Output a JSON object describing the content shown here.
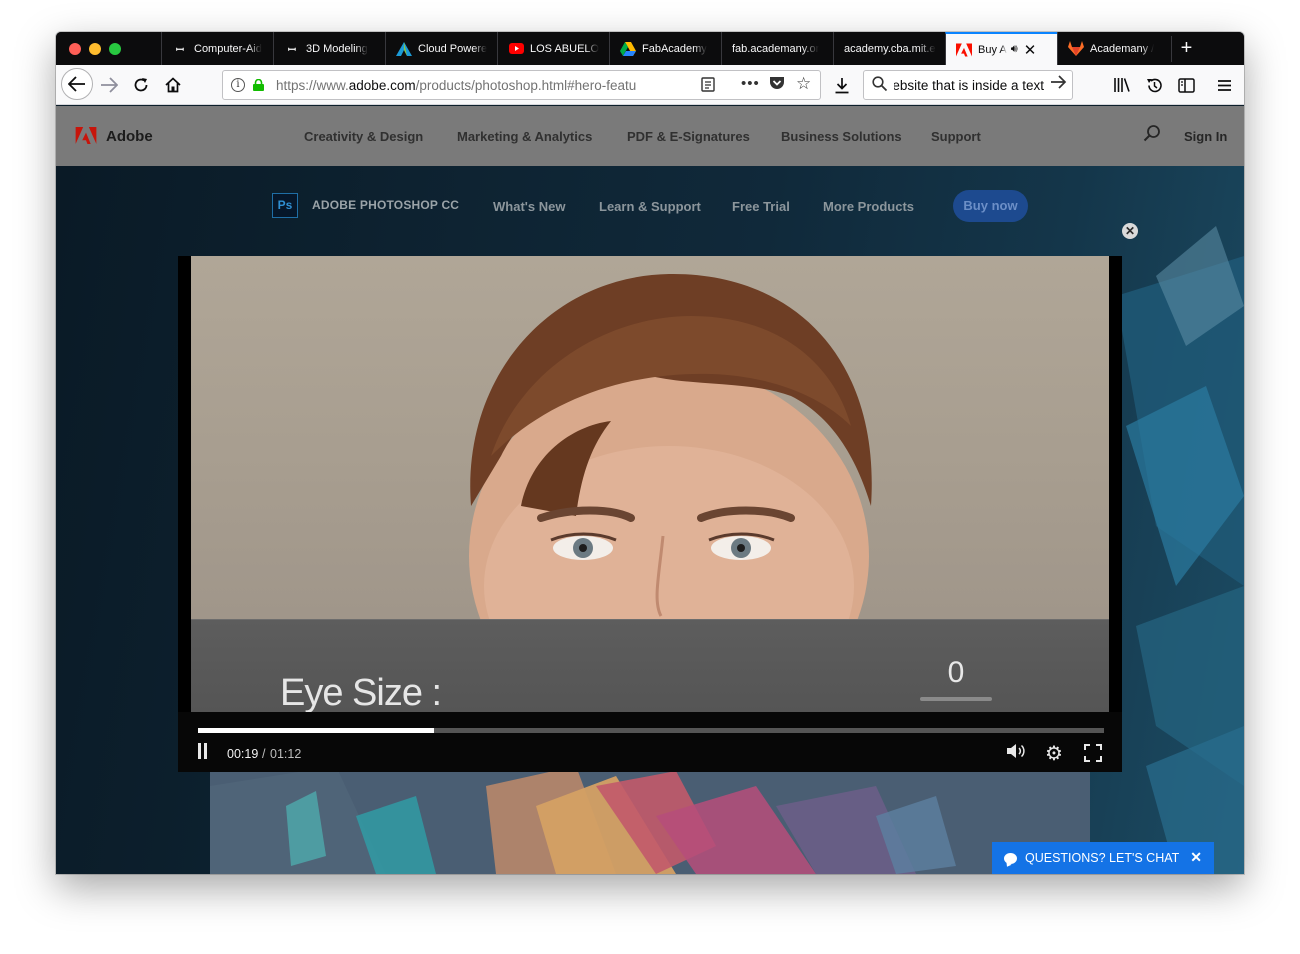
{
  "browser": {
    "tabs": [
      {
        "label": "Computer-Aid",
        "icon": "book-icon"
      },
      {
        "label": "3D Modeling",
        "icon": "book-icon"
      },
      {
        "label": "Cloud Powere",
        "icon": "autodesk-icon"
      },
      {
        "label": "LOS ABUELO",
        "icon": "youtube-icon"
      },
      {
        "label": "FabAcademy",
        "icon": "google-drive-icon"
      },
      {
        "label": "fab.academany.or",
        "icon": ""
      },
      {
        "label": "academy.cba.mit.e",
        "icon": ""
      },
      {
        "label": "Buy A",
        "icon": "adobe-icon",
        "active": true
      },
      {
        "label": "Academany /",
        "icon": "gitlab-icon"
      }
    ],
    "url_prefix": "https://www.",
    "url_domain": "adobe.com",
    "url_path": "/products/photoshop.html#hero-featu",
    "search_text": "ebsite that is inside a text",
    "new_tab": "+"
  },
  "adobe_nav": {
    "brand": "Adobe",
    "items": [
      "Creativity & Design",
      "Marketing & Analytics",
      "PDF & E-Signatures",
      "Business Solutions",
      "Support"
    ],
    "sign_in": "Sign In"
  },
  "product_nav": {
    "badge": "Ps",
    "name": "ADOBE PHOTOSHOP CC",
    "items": [
      "What's New",
      "Learn & Support",
      "Free Trial",
      "More Products"
    ],
    "buy_now": "Buy now"
  },
  "video": {
    "overlay_label": "Eye Size :",
    "overlay_value": "0",
    "current_time": "00:19",
    "separator": "/",
    "duration": "01:12",
    "progress": 0.26
  },
  "chat": {
    "label": "QUESTIONS? LET'S CHAT",
    "close": "✕"
  },
  "colors": {
    "tab_active_accent": "#0a84ff",
    "chat": "#1473e6",
    "buy_now": "#1d4a8f"
  }
}
